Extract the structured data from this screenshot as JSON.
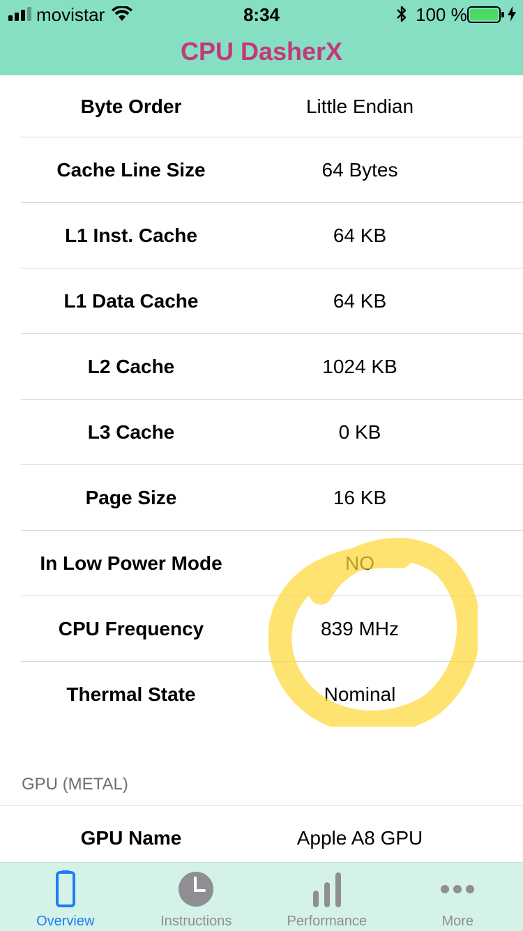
{
  "status_bar": {
    "carrier": "movistar",
    "time": "8:34",
    "battery_percent": "100 %"
  },
  "app": {
    "title": "CPU DasherX",
    "title_color": "#c4377a",
    "bar_color": "#86dec3"
  },
  "rows": [
    {
      "label": "Byte Order",
      "value": "Little Endian"
    },
    {
      "label": "Cache Line Size",
      "value": "64 Bytes"
    },
    {
      "label": "L1 Inst. Cache",
      "value": "64 KB"
    },
    {
      "label": "L1 Data Cache",
      "value": "64 KB"
    },
    {
      "label": "L2 Cache",
      "value": "1024 KB"
    },
    {
      "label": "L3 Cache",
      "value": "0 KB"
    },
    {
      "label": "Page Size",
      "value": "16 KB"
    },
    {
      "label": "In Low Power Mode",
      "value": "NO"
    },
    {
      "label": "CPU Frequency",
      "value": "839 MHz"
    },
    {
      "label": "Thermal State",
      "value": "Nominal"
    }
  ],
  "gpu_section": {
    "header": "GPU (METAL)",
    "rows": [
      {
        "label": "GPU Name",
        "value": "Apple A8 GPU"
      }
    ]
  },
  "tabs": [
    {
      "label": "Overview",
      "icon": "phone-icon",
      "active": true
    },
    {
      "label": "Instructions",
      "icon": "clock-icon",
      "active": false
    },
    {
      "label": "Performance",
      "icon": "bar-chart-icon",
      "active": false
    },
    {
      "label": "More",
      "icon": "more-dots-icon",
      "active": false
    }
  ],
  "colors": {
    "active_tab": "#1a7ff7",
    "inactive_tab": "#8e8e93",
    "tab_bar_bg": "#d4f2e7",
    "highlight": "#ffd83a"
  }
}
